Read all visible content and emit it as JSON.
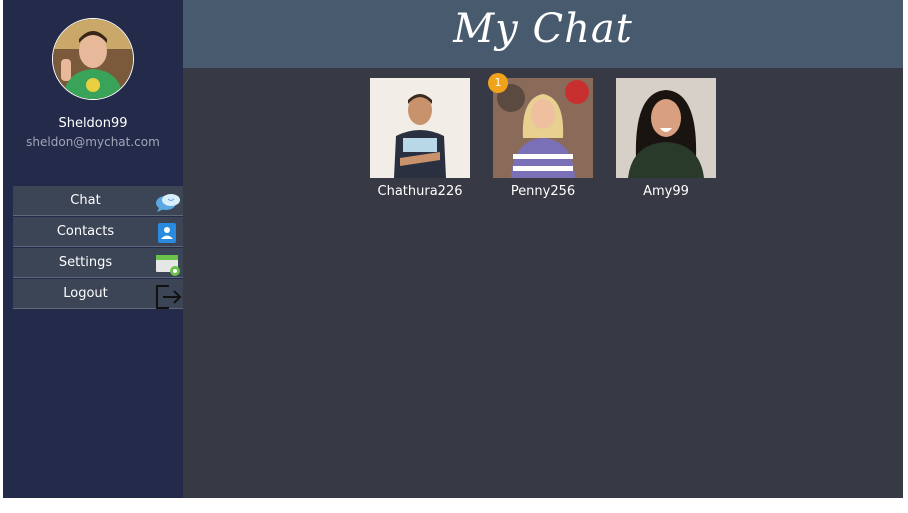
{
  "app": {
    "title": "My Chat"
  },
  "profile": {
    "username": "Sheldon99",
    "email": "sheldon@mychat.com"
  },
  "menu": [
    {
      "label": "Chat",
      "icon": "chat-bubbles-icon"
    },
    {
      "label": "Contacts",
      "icon": "contacts-icon"
    },
    {
      "label": "Settings",
      "icon": "settings-card-icon"
    },
    {
      "label": "Logout",
      "icon": "logout-icon"
    }
  ],
  "contacts": [
    {
      "name": "Chathura226",
      "badge": ""
    },
    {
      "name": "Penny256",
      "badge": "1"
    },
    {
      "name": "Amy99",
      "badge": ""
    }
  ],
  "colors": {
    "sidebar": "#242a4a",
    "header": "#475a6e",
    "main": "#373945",
    "badge": "#f0a21a"
  }
}
